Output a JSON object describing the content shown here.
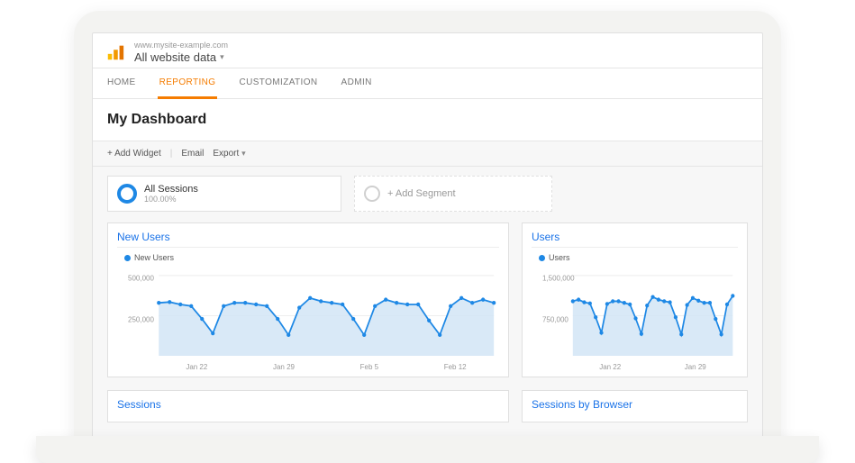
{
  "header": {
    "site_url": "www.mysite-example.com",
    "view_name": "All website data"
  },
  "nav": {
    "items": [
      "HOME",
      "REPORTING",
      "CUSTOMIZATION",
      "ADMIN"
    ],
    "active_index": 1
  },
  "page": {
    "title": "My Dashboard"
  },
  "toolbar": {
    "add_widget": "+ Add Widget",
    "email": "Email",
    "export": "Export"
  },
  "segments": {
    "primary": {
      "title": "All Sessions",
      "sub": "100.00%"
    },
    "add_label": "+ Add Segment"
  },
  "cards": {
    "new_users": {
      "title": "New Users",
      "legend": "New Users"
    },
    "users": {
      "title": "Users",
      "legend": "Users"
    },
    "sessions": {
      "title": "Sessions"
    },
    "sessions_by_browser": {
      "title": "Sessions by Browser"
    }
  },
  "chart_data": [
    {
      "id": "new_users",
      "type": "line",
      "title": "New Users",
      "ylabel": "",
      "ylim": [
        0,
        550000
      ],
      "yticks": [
        250000,
        500000
      ],
      "ytick_labels": [
        "250,000",
        "500,000"
      ],
      "x_labels": [
        "Jan 22",
        "Jan 29",
        "Feb 5",
        "Feb 12"
      ],
      "series": [
        {
          "name": "New Users",
          "values": [
            330000,
            335000,
            320000,
            310000,
            230000,
            140000,
            310000,
            330000,
            330000,
            320000,
            310000,
            230000,
            130000,
            300000,
            360000,
            340000,
            330000,
            320000,
            230000,
            130000,
            310000,
            350000,
            330000,
            320000,
            320000,
            220000,
            130000,
            310000,
            360000,
            330000,
            350000,
            330000
          ]
        }
      ]
    },
    {
      "id": "users",
      "type": "line",
      "title": "Users",
      "ylabel": "",
      "ylim": [
        0,
        1650000
      ],
      "yticks": [
        750000,
        1500000
      ],
      "ytick_labels": [
        "750,000",
        "1,500,000"
      ],
      "x_labels": [
        "Jan 22",
        "Jan 29"
      ],
      "series": [
        {
          "name": "Users",
          "values": [
            1020000,
            1050000,
            1000000,
            980000,
            720000,
            430000,
            970000,
            1020000,
            1020000,
            990000,
            960000,
            700000,
            410000,
            940000,
            1100000,
            1050000,
            1020000,
            1000000,
            720000,
            400000,
            950000,
            1080000,
            1030000,
            990000,
            990000,
            690000,
            400000,
            960000,
            1120000
          ]
        }
      ]
    }
  ]
}
